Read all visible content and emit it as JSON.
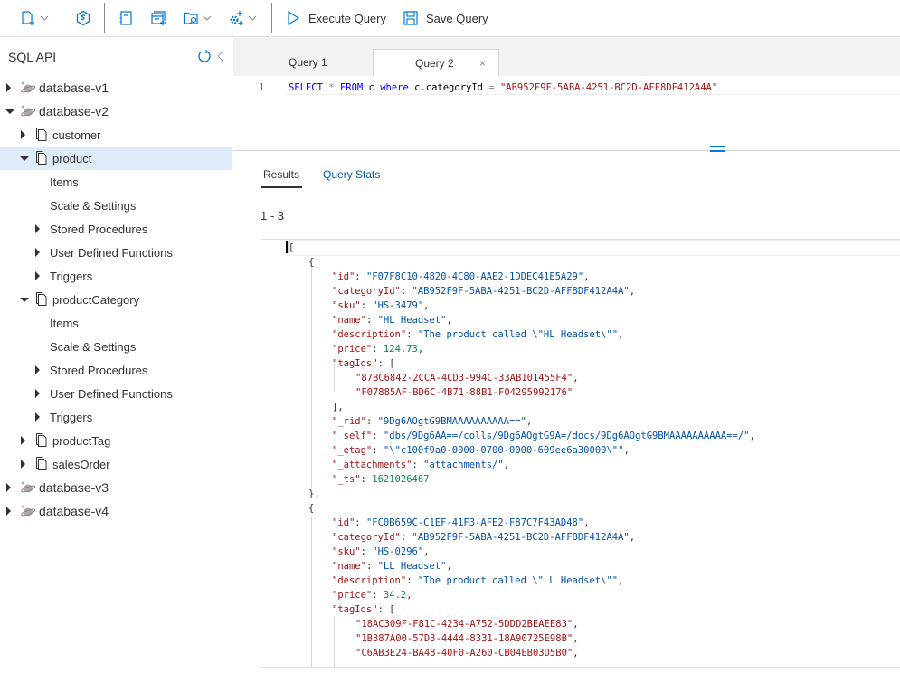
{
  "toolbar": {
    "new_container_icon": "new-container-icon",
    "cosmos_icon": "cosmos-shell-icon",
    "notebook_icon": "notebook-icon",
    "new_query_icon": "new-sql-query-icon",
    "open_query_icon": "open-query-icon",
    "settings_icon": "settings-gear-icon",
    "execute_label": "Execute Query",
    "save_label": "Save Query"
  },
  "sidebar": {
    "title": "SQL API",
    "tree": [
      {
        "label": "database-v1",
        "type": "database",
        "level": 0,
        "expanded": false
      },
      {
        "label": "database-v2",
        "type": "database",
        "level": 0,
        "expanded": true
      },
      {
        "label": "customer",
        "type": "container",
        "level": 1,
        "expanded": false
      },
      {
        "label": "product",
        "type": "container",
        "level": 1,
        "expanded": true,
        "selected": true
      },
      {
        "label": "Items",
        "type": "leaf",
        "level": 2
      },
      {
        "label": "Scale & Settings",
        "type": "leaf",
        "level": 2
      },
      {
        "label": "Stored Procedures",
        "type": "group",
        "level": 2,
        "expanded": false
      },
      {
        "label": "User Defined Functions",
        "type": "group",
        "level": 2,
        "expanded": false
      },
      {
        "label": "Triggers",
        "type": "group",
        "level": 2,
        "expanded": false
      },
      {
        "label": "productCategory",
        "type": "container",
        "level": 1,
        "expanded": true
      },
      {
        "label": "Items",
        "type": "leaf",
        "level": 2
      },
      {
        "label": "Scale & Settings",
        "type": "leaf",
        "level": 2
      },
      {
        "label": "Stored Procedures",
        "type": "group",
        "level": 2,
        "expanded": false
      },
      {
        "label": "User Defined Functions",
        "type": "group",
        "level": 2,
        "expanded": false
      },
      {
        "label": "Triggers",
        "type": "group",
        "level": 2,
        "expanded": false
      },
      {
        "label": "productTag",
        "type": "container",
        "level": 1,
        "expanded": false
      },
      {
        "label": "salesOrder",
        "type": "container",
        "level": 1,
        "expanded": false
      },
      {
        "label": "database-v3",
        "type": "database",
        "level": 0,
        "expanded": false
      },
      {
        "label": "database-v4",
        "type": "database",
        "level": 0,
        "expanded": false
      }
    ]
  },
  "tabs": [
    {
      "label": "Query 1",
      "active": false
    },
    {
      "label": "Query 2",
      "active": true,
      "close": "×"
    }
  ],
  "editor": {
    "line_number": "1",
    "tokens": [
      {
        "t": "SELECT",
        "c": "kw"
      },
      {
        "t": " ",
        "c": "id"
      },
      {
        "t": "*",
        "c": "op"
      },
      {
        "t": " ",
        "c": "id"
      },
      {
        "t": "FROM",
        "c": "kw"
      },
      {
        "t": " c ",
        "c": "id"
      },
      {
        "t": "where",
        "c": "kw"
      },
      {
        "t": " c.categoryId ",
        "c": "id"
      },
      {
        "t": "=",
        "c": "op"
      },
      {
        "t": " ",
        "c": "id"
      },
      {
        "t": "\"AB952F9F-5ABA-4251-BC2D-AFF8DF412A4A\"",
        "c": "str"
      }
    ]
  },
  "results": {
    "tabs": [
      {
        "label": "Results",
        "active": true
      },
      {
        "label": "Query Stats",
        "active": false
      }
    ],
    "range": "1 - 3",
    "json_lines": [
      {
        "indent": 0,
        "parts": [
          [
            "[",
            "jp"
          ]
        ]
      },
      {
        "indent": 1,
        "parts": [
          [
            "{",
            "jp"
          ]
        ]
      },
      {
        "indent": 2,
        "parts": [
          [
            "\"id\"",
            "jk"
          ],
          [
            ": ",
            "jp"
          ],
          [
            "\"F07F8C10-4820-4C80-AAE2-1DDEC41E5A29\"",
            "js"
          ],
          [
            ",",
            "jp"
          ]
        ]
      },
      {
        "indent": 2,
        "parts": [
          [
            "\"categoryId\"",
            "jk"
          ],
          [
            ": ",
            "jp"
          ],
          [
            "\"AB952F9F-5ABA-4251-BC2D-AFF8DF412A4A\"",
            "js"
          ],
          [
            ",",
            "jp"
          ]
        ]
      },
      {
        "indent": 2,
        "parts": [
          [
            "\"sku\"",
            "jk"
          ],
          [
            ": ",
            "jp"
          ],
          [
            "\"HS-3479\"",
            "js"
          ],
          [
            ",",
            "jp"
          ]
        ]
      },
      {
        "indent": 2,
        "parts": [
          [
            "\"name\"",
            "jk"
          ],
          [
            ": ",
            "jp"
          ],
          [
            "\"HL Headset\"",
            "js"
          ],
          [
            ",",
            "jp"
          ]
        ]
      },
      {
        "indent": 2,
        "parts": [
          [
            "\"description\"",
            "jk"
          ],
          [
            ": ",
            "jp"
          ],
          [
            "\"The product called \\\"HL Headset\\\"\"",
            "js"
          ],
          [
            ",",
            "jp"
          ]
        ]
      },
      {
        "indent": 2,
        "parts": [
          [
            "\"price\"",
            "jk"
          ],
          [
            ": ",
            "jp"
          ],
          [
            "124.73",
            "jn"
          ],
          [
            ",",
            "jp"
          ]
        ]
      },
      {
        "indent": 2,
        "parts": [
          [
            "\"tagIds\"",
            "jk"
          ],
          [
            ": [",
            "jp"
          ]
        ]
      },
      {
        "indent": 3,
        "parts": [
          [
            "\"87BC6842-2CCA-4CD3-994C-33AB101455F4\"",
            "jtag"
          ],
          [
            ",",
            "jp"
          ]
        ]
      },
      {
        "indent": 3,
        "parts": [
          [
            "\"F07885AF-BD6C-4B71-88B1-F04295992176\"",
            "jtag"
          ]
        ]
      },
      {
        "indent": 2,
        "parts": [
          [
            "],",
            "jp"
          ]
        ]
      },
      {
        "indent": 2,
        "parts": [
          [
            "\"_rid\"",
            "jk"
          ],
          [
            ": ",
            "jp"
          ],
          [
            "\"9Dg6AOgtG9BMAAAAAAAAAA==\"",
            "js"
          ],
          [
            ",",
            "jp"
          ]
        ]
      },
      {
        "indent": 2,
        "parts": [
          [
            "\"_self\"",
            "jk"
          ],
          [
            ": ",
            "jp"
          ],
          [
            "\"dbs/9Dg6AA==/colls/9Dg6AOgtG9A=/docs/9Dg6AOgtG9BMAAAAAAAAAA==/\"",
            "js"
          ],
          [
            ",",
            "jp"
          ]
        ]
      },
      {
        "indent": 2,
        "parts": [
          [
            "\"_etag\"",
            "jk"
          ],
          [
            ": ",
            "jp"
          ],
          [
            "\"\\\"c100f9a0-0000-0700-0000-609ee6a30000\\\"\"",
            "js"
          ],
          [
            ",",
            "jp"
          ]
        ]
      },
      {
        "indent": 2,
        "parts": [
          [
            "\"_attachments\"",
            "jk"
          ],
          [
            ": ",
            "jp"
          ],
          [
            "\"attachments/\"",
            "js"
          ],
          [
            ",",
            "jp"
          ]
        ]
      },
      {
        "indent": 2,
        "parts": [
          [
            "\"_ts\"",
            "jk"
          ],
          [
            ": ",
            "jp"
          ],
          [
            "1621026467",
            "jn"
          ]
        ]
      },
      {
        "indent": 1,
        "parts": [
          [
            "},",
            "jp"
          ]
        ]
      },
      {
        "indent": 1,
        "parts": [
          [
            "{",
            "jp"
          ]
        ]
      },
      {
        "indent": 2,
        "parts": [
          [
            "\"id\"",
            "jk"
          ],
          [
            ": ",
            "jp"
          ],
          [
            "\"FC0B659C-C1EF-41F3-AFE2-F87C7F43AD48\"",
            "js"
          ],
          [
            ",",
            "jp"
          ]
        ]
      },
      {
        "indent": 2,
        "parts": [
          [
            "\"categoryId\"",
            "jk"
          ],
          [
            ": ",
            "jp"
          ],
          [
            "\"AB952F9F-5ABA-4251-BC2D-AFF8DF412A4A\"",
            "js"
          ],
          [
            ",",
            "jp"
          ]
        ]
      },
      {
        "indent": 2,
        "parts": [
          [
            "\"sku\"",
            "jk"
          ],
          [
            ": ",
            "jp"
          ],
          [
            "\"HS-0296\"",
            "js"
          ],
          [
            ",",
            "jp"
          ]
        ]
      },
      {
        "indent": 2,
        "parts": [
          [
            "\"name\"",
            "jk"
          ],
          [
            ": ",
            "jp"
          ],
          [
            "\"LL Headset\"",
            "js"
          ],
          [
            ",",
            "jp"
          ]
        ]
      },
      {
        "indent": 2,
        "parts": [
          [
            "\"description\"",
            "jk"
          ],
          [
            ": ",
            "jp"
          ],
          [
            "\"The product called \\\"LL Headset\\\"\"",
            "js"
          ],
          [
            ",",
            "jp"
          ]
        ]
      },
      {
        "indent": 2,
        "parts": [
          [
            "\"price\"",
            "jk"
          ],
          [
            ": ",
            "jp"
          ],
          [
            "34.2",
            "jn"
          ],
          [
            ",",
            "jp"
          ]
        ]
      },
      {
        "indent": 2,
        "parts": [
          [
            "\"tagIds\"",
            "jk"
          ],
          [
            ": [",
            "jp"
          ]
        ]
      },
      {
        "indent": 3,
        "parts": [
          [
            "\"18AC309F-F81C-4234-A752-5DDD2BEAEE83\"",
            "jtag"
          ],
          [
            ",",
            "jp"
          ]
        ]
      },
      {
        "indent": 3,
        "parts": [
          [
            "\"1B387A00-57D3-4444-8331-18A90725E98B\"",
            "jtag"
          ],
          [
            ",",
            "jp"
          ]
        ]
      },
      {
        "indent": 3,
        "parts": [
          [
            "\"C6AB3E24-BA48-40F0-A260-CB04EB03D5B0\"",
            "jtag"
          ],
          [
            ",",
            "jp"
          ]
        ]
      }
    ]
  }
}
